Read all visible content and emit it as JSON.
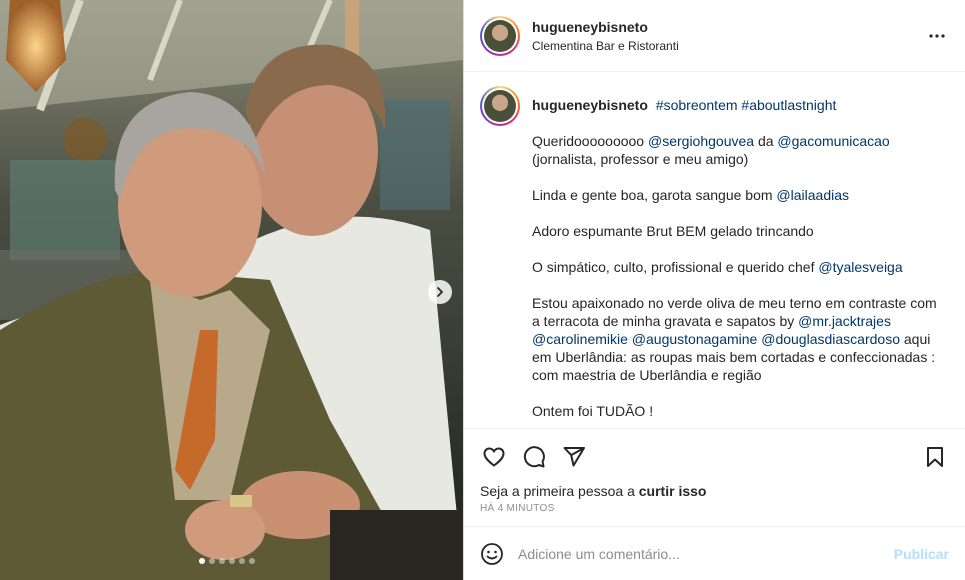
{
  "post": {
    "username": "hugueneybisneto",
    "location": "Clementina Bar e Ristoranti",
    "more_icon": "more-horizontal-icon"
  },
  "caption": {
    "username": "hugueneybisneto",
    "hashtags": [
      "#sobreontem",
      "#aboutlastnight"
    ],
    "p1": {
      "a": "Queridooooooooo ",
      "t1": "@sergiohgouvea",
      "b": " da ",
      "t2": "@gacomunicacao",
      "c": " (jornalista, professor e meu amigo)"
    },
    "p2": {
      "a": "Linda e gente boa, garota sangue bom ",
      "t1": "@lailaadias"
    },
    "p3": {
      "a": "Adoro espumante Brut BEM gelado trincando"
    },
    "p4": {
      "a": "O simpático, culto, profissional e querido chef ",
      "t1": "@tyalesveiga"
    },
    "p5": {
      "a": "Estou apaixonado no verde oliva de meu terno em contraste com a terracota de minha gravata e sapatos by ",
      "t1": "@mr.jacktrajes",
      "t2": "@carolinemikie",
      "t3": "@augustonagamine",
      "t4": "@douglasdiascardoso",
      "b": " aqui em Uberlândia: as roupas mais bem cortadas e confeccionadas : com maestria de Uberlândia e região"
    },
    "p6": {
      "a": "Ontem foi TUDÃO !"
    }
  },
  "actions": {
    "like_icon": "heart-icon",
    "comment_icon": "comment-icon",
    "share_icon": "share-icon",
    "save_icon": "bookmark-icon"
  },
  "likes": {
    "prefix": "Seja a primeira pessoa a ",
    "bold": "curtir isso"
  },
  "timestamp": "HÁ 4 MINUTOS",
  "comment_box": {
    "placeholder": "Adicione um comentário...",
    "publish_label": "Publicar",
    "emoji_icon": "emoji-icon"
  },
  "carousel": {
    "dots_total": 6,
    "active_index": 0
  },
  "colors": {
    "link": "#00376b",
    "publish_disabled": "#b2dffc",
    "muted": "#8e8e8e"
  }
}
